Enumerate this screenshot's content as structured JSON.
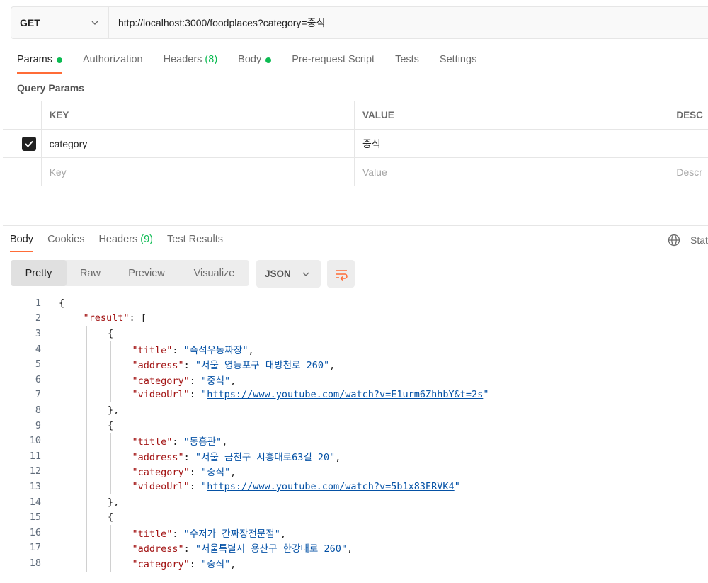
{
  "request": {
    "method": "GET",
    "url": "http://localhost:3000/foodplaces?category=중식"
  },
  "request_tabs": [
    {
      "label": "Params",
      "dot": true
    },
    {
      "label": "Authorization"
    },
    {
      "label": "Headers",
      "count": "(8)"
    },
    {
      "label": "Body",
      "dot": true
    },
    {
      "label": "Pre-request Script"
    },
    {
      "label": "Tests"
    },
    {
      "label": "Settings"
    }
  ],
  "query_params": {
    "title": "Query Params",
    "columns": [
      "KEY",
      "VALUE",
      "DESC"
    ],
    "rows": [
      {
        "checked": true,
        "key": "category",
        "value": "중식"
      }
    ],
    "placeholders": {
      "key": "Key",
      "value": "Value",
      "desc": "Descr"
    }
  },
  "response_tabs": [
    {
      "label": "Body"
    },
    {
      "label": "Cookies"
    },
    {
      "label": "Headers",
      "count": "(9)"
    },
    {
      "label": "Test Results"
    }
  ],
  "status_label": "Stat",
  "views": [
    "Pretty",
    "Raw",
    "Preview",
    "Visualize"
  ],
  "format": "JSON",
  "accent_color": "#ff6c37",
  "status_color": "#0cbb52",
  "code_lines": [
    {
      "n": "1",
      "indent": 0,
      "parts": [
        [
          "p",
          "{"
        ]
      ]
    },
    {
      "n": "2",
      "indent": 1,
      "parts": [
        [
          "k",
          "\"result\""
        ],
        [
          "p",
          ": ["
        ]
      ]
    },
    {
      "n": "3",
      "indent": 2,
      "parts": [
        [
          "p",
          "{"
        ]
      ]
    },
    {
      "n": "4",
      "indent": 3,
      "parts": [
        [
          "k",
          "\"title\""
        ],
        [
          "p",
          ": "
        ],
        [
          "s",
          "\"즉석우동짜장\""
        ],
        [
          "p",
          ","
        ]
      ]
    },
    {
      "n": "5",
      "indent": 3,
      "parts": [
        [
          "k",
          "\"address\""
        ],
        [
          "p",
          ": "
        ],
        [
          "s",
          "\"서울 영등포구 대방천로 260\""
        ],
        [
          "p",
          ","
        ]
      ]
    },
    {
      "n": "6",
      "indent": 3,
      "parts": [
        [
          "k",
          "\"category\""
        ],
        [
          "p",
          ": "
        ],
        [
          "s",
          "\"중식\""
        ],
        [
          "p",
          ","
        ]
      ]
    },
    {
      "n": "7",
      "indent": 3,
      "parts": [
        [
          "k",
          "\"videoUrl\""
        ],
        [
          "p",
          ": "
        ],
        [
          "s",
          "\""
        ],
        [
          "l",
          "https://www.youtube.com/watch?v=E1urm6ZhhbY&t=2s"
        ],
        [
          "s",
          "\""
        ]
      ]
    },
    {
      "n": "8",
      "indent": 2,
      "parts": [
        [
          "p",
          "},"
        ]
      ]
    },
    {
      "n": "9",
      "indent": 2,
      "parts": [
        [
          "p",
          "{"
        ]
      ]
    },
    {
      "n": "10",
      "indent": 3,
      "parts": [
        [
          "k",
          "\"title\""
        ],
        [
          "p",
          ": "
        ],
        [
          "s",
          "\"동흥관\""
        ],
        [
          "p",
          ","
        ]
      ]
    },
    {
      "n": "11",
      "indent": 3,
      "parts": [
        [
          "k",
          "\"address\""
        ],
        [
          "p",
          ": "
        ],
        [
          "s",
          "\"서울 금천구 시흥대로63길 20\""
        ],
        [
          "p",
          ","
        ]
      ]
    },
    {
      "n": "12",
      "indent": 3,
      "parts": [
        [
          "k",
          "\"category\""
        ],
        [
          "p",
          ": "
        ],
        [
          "s",
          "\"중식\""
        ],
        [
          "p",
          ","
        ]
      ]
    },
    {
      "n": "13",
      "indent": 3,
      "parts": [
        [
          "k",
          "\"videoUrl\""
        ],
        [
          "p",
          ": "
        ],
        [
          "s",
          "\""
        ],
        [
          "l",
          "https://www.youtube.com/watch?v=5b1x83ERVK4"
        ],
        [
          "s",
          "\""
        ]
      ]
    },
    {
      "n": "14",
      "indent": 2,
      "parts": [
        [
          "p",
          "},"
        ]
      ]
    },
    {
      "n": "15",
      "indent": 2,
      "parts": [
        [
          "p",
          "{"
        ]
      ]
    },
    {
      "n": "16",
      "indent": 3,
      "parts": [
        [
          "k",
          "\"title\""
        ],
        [
          "p",
          ": "
        ],
        [
          "s",
          "\"수저가 간짜장전문점\""
        ],
        [
          "p",
          ","
        ]
      ]
    },
    {
      "n": "17",
      "indent": 3,
      "parts": [
        [
          "k",
          "\"address\""
        ],
        [
          "p",
          ": "
        ],
        [
          "s",
          "\"서울특별시 용산구 한강대로 260\""
        ],
        [
          "p",
          ","
        ]
      ]
    },
    {
      "n": "18",
      "indent": 3,
      "parts": [
        [
          "k",
          "\"category\""
        ],
        [
          "p",
          ": "
        ],
        [
          "s",
          "\"중식\""
        ],
        [
          "p",
          ","
        ]
      ]
    }
  ]
}
